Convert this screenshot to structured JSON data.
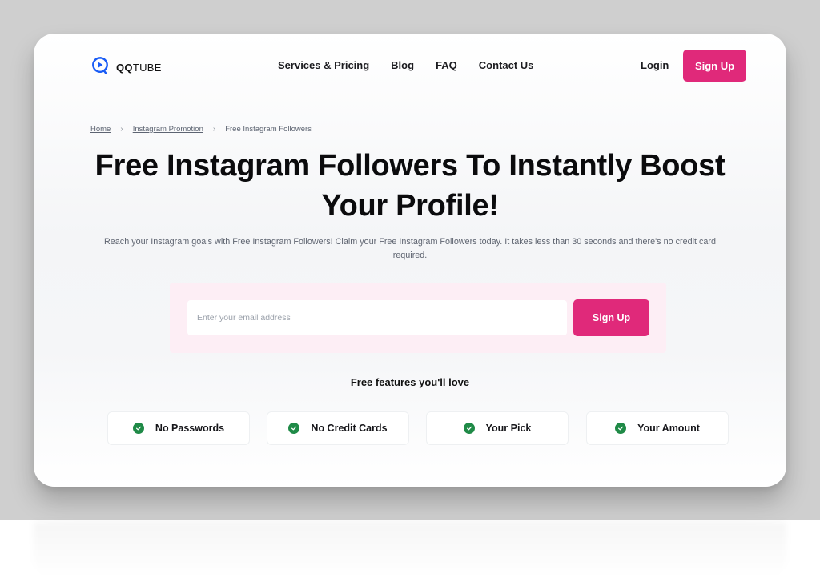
{
  "brand": {
    "logo_bold": "QQ",
    "logo_light": "TUBE",
    "logo_icon": "play-circle-icon",
    "accent_color": "#e0297a",
    "logo_color": "#1a5cf5",
    "check_color": "#1f8a47"
  },
  "nav": {
    "items": [
      {
        "label": "Services & Pricing"
      },
      {
        "label": "Blog"
      },
      {
        "label": "FAQ"
      },
      {
        "label": "Contact Us"
      }
    ],
    "login_label": "Login",
    "signup_label": "Sign Up"
  },
  "breadcrumb": {
    "items": [
      {
        "label": "Home"
      },
      {
        "label": "Instagram Promotion"
      },
      {
        "label": "Free Instagram Followers"
      }
    ],
    "separator_icon": "chevron-right-icon"
  },
  "hero": {
    "title": "Free Instagram Followers To Instantly Boost Your Profile!",
    "subtitle": "Reach your Instagram goals with Free Instagram Followers! Claim your Free Instagram Followers today. It takes less than 30 seconds and there's no credit card required."
  },
  "form": {
    "email_placeholder": "Enter your email address",
    "email_value": "",
    "submit_label": "Sign Up"
  },
  "features": {
    "title": "Free features you'll love",
    "items": [
      {
        "label": "No Passwords",
        "icon": "check-circle-icon"
      },
      {
        "label": "No Credit Cards",
        "icon": "check-circle-icon"
      },
      {
        "label": "Your Pick",
        "icon": "check-circle-icon"
      },
      {
        "label": "Your Amount",
        "icon": "check-circle-icon"
      }
    ]
  }
}
